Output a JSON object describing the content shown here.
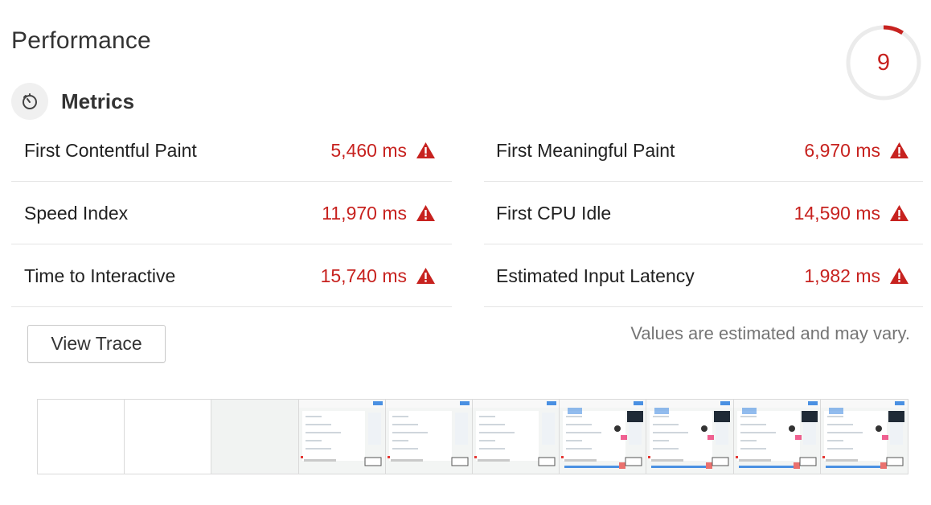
{
  "category": {
    "title": "Performance",
    "score": "9",
    "score_fraction": 0.09,
    "score_color": "#c7221f"
  },
  "metrics": {
    "heading": "Metrics",
    "icon": "stopwatch-icon",
    "left": [
      {
        "label": "First Contentful Paint",
        "value": "5,460 ms",
        "status": "fail"
      },
      {
        "label": "Speed Index",
        "value": "11,970 ms",
        "status": "fail"
      },
      {
        "label": "Time to Interactive",
        "value": "15,740 ms",
        "status": "fail"
      }
    ],
    "right": [
      {
        "label": "First Meaningful Paint",
        "value": "6,970 ms",
        "status": "fail"
      },
      {
        "label": "First CPU Idle",
        "value": "14,590 ms",
        "status": "fail"
      },
      {
        "label": "Estimated Input Latency",
        "value": "1,982 ms",
        "status": "fail"
      }
    ],
    "warning_icon": "warning-triangle-icon",
    "fail_color": "#c7221f"
  },
  "actions": {
    "view_trace_label": "View Trace"
  },
  "disclaimer": "Values are estimated and may vary.",
  "filmstrip": {
    "frames": [
      {
        "state": "blank"
      },
      {
        "state": "blank"
      },
      {
        "state": "gray"
      },
      {
        "state": "partial"
      },
      {
        "state": "partial"
      },
      {
        "state": "partial"
      },
      {
        "state": "loaded"
      },
      {
        "state": "loaded"
      },
      {
        "state": "loaded"
      },
      {
        "state": "loaded"
      }
    ]
  }
}
